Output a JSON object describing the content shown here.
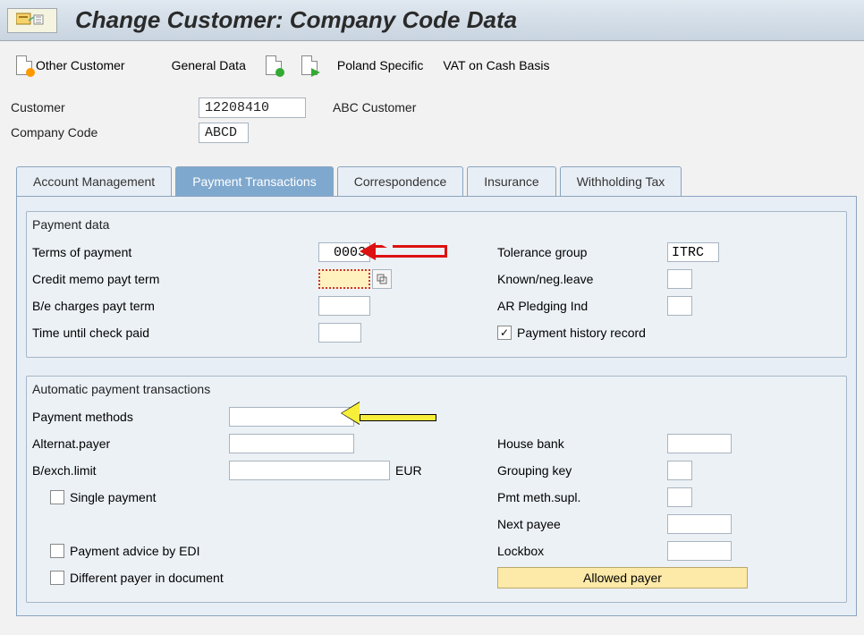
{
  "title": "Change Customer: Company Code Data",
  "toolbar": {
    "other_customer": "Other Customer",
    "general_data": "General Data",
    "poland_specific": "Poland Specific",
    "vat_cash": "VAT on Cash Basis"
  },
  "header": {
    "customer_label": "Customer",
    "customer_value": "12208410",
    "customer_desc": "ABC Customer",
    "company_code_label": "Company Code",
    "company_code_value": "ABCD"
  },
  "tabs": {
    "t1": "Account Management",
    "t2": "Payment Transactions",
    "t3": "Correspondence",
    "t4": "Insurance",
    "t5": "Withholding Tax"
  },
  "payment_data": {
    "group_title": "Payment data",
    "terms_of_payment_label": "Terms of payment",
    "terms_of_payment_value": "0003",
    "credit_memo_label": "Credit memo payt term",
    "credit_memo_value": "",
    "be_charges_label": "B/e charges payt term",
    "be_charges_value": "",
    "time_until_label": "Time until check paid",
    "time_until_value": "",
    "tolerance_group_label": "Tolerance group",
    "tolerance_group_value": "ITRC",
    "known_neg_label": "Known/neg.leave",
    "known_neg_value": "",
    "ar_pledging_label": "AR Pledging Ind",
    "ar_pledging_value": "",
    "payment_history_label": "Payment history record",
    "payment_history_checked": "✓"
  },
  "auto_pay": {
    "group_title": "Automatic payment transactions",
    "payment_methods_label": "Payment methods",
    "payment_methods_value": "",
    "alt_payer_label": "Alternat.payer",
    "alt_payer_value": "",
    "bexch_limit_label": "B/exch.limit",
    "bexch_limit_value": "",
    "bexch_limit_unit": "EUR",
    "single_payment_label": "Single payment",
    "pay_advice_edi_label": "Payment advice by EDI",
    "diff_payer_doc_label": "Different payer in document",
    "house_bank_label": "House bank",
    "house_bank_value": "",
    "grouping_key_label": "Grouping key",
    "grouping_key_value": "",
    "pmt_meth_supl_label": "Pmt meth.supl.",
    "pmt_meth_supl_value": "",
    "next_payee_label": "Next payee",
    "next_payee_value": "",
    "lockbox_label": "Lockbox",
    "lockbox_value": "",
    "allowed_payer_label": "Allowed payer"
  }
}
